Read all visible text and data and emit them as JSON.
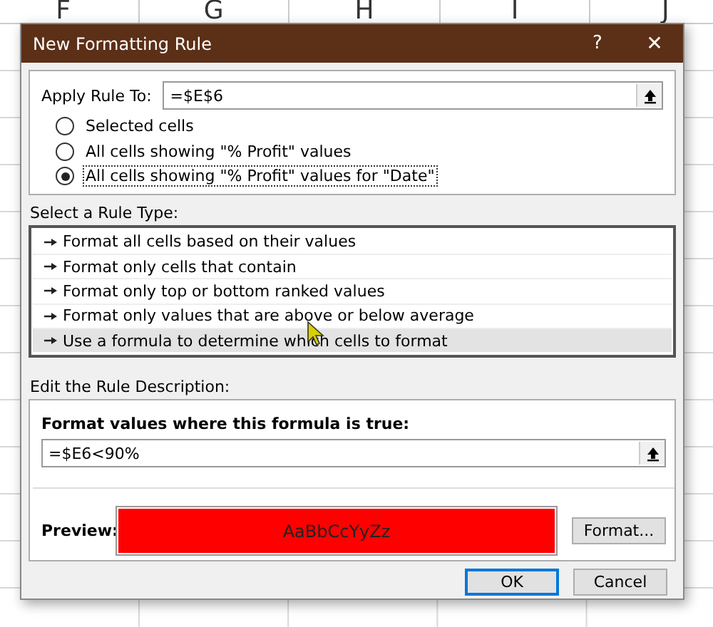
{
  "sheet": {
    "columns": [
      "F",
      "G",
      "H",
      "I",
      "J"
    ]
  },
  "dialog": {
    "title": "New Formatting Rule",
    "help": "?",
    "close": "✕",
    "apply_rule_to": {
      "label": "Apply Rule To:",
      "value": "=$E$6"
    },
    "scope_options": [
      {
        "label": "Selected cells",
        "selected": false
      },
      {
        "label": "All cells showing \"% Profit\" values",
        "selected": false
      },
      {
        "label": "All cells showing \"% Profit\" values for \"Date\"",
        "selected": true
      }
    ],
    "rule_type_label": "Select a Rule Type:",
    "rule_types": [
      {
        "label": "Format all cells based on their values",
        "selected": false
      },
      {
        "label": "Format only cells that contain",
        "selected": false
      },
      {
        "label": "Format only top or bottom ranked values",
        "selected": false
      },
      {
        "label": "Format only values that are above or below average",
        "selected": false
      },
      {
        "label": "Use a formula to determine which cells to format",
        "selected": true
      }
    ],
    "description_label": "Edit the Rule Description:",
    "formula_label": "Format values where this formula is true:",
    "formula": "=$E6<90%",
    "preview": {
      "label": "Preview:",
      "sample": "AaBbCcYyZz",
      "color": "#ff0000"
    },
    "format_button": "Format...",
    "buttons": [
      {
        "label": "OK",
        "default": true
      },
      {
        "label": "Cancel",
        "default": false
      }
    ]
  }
}
